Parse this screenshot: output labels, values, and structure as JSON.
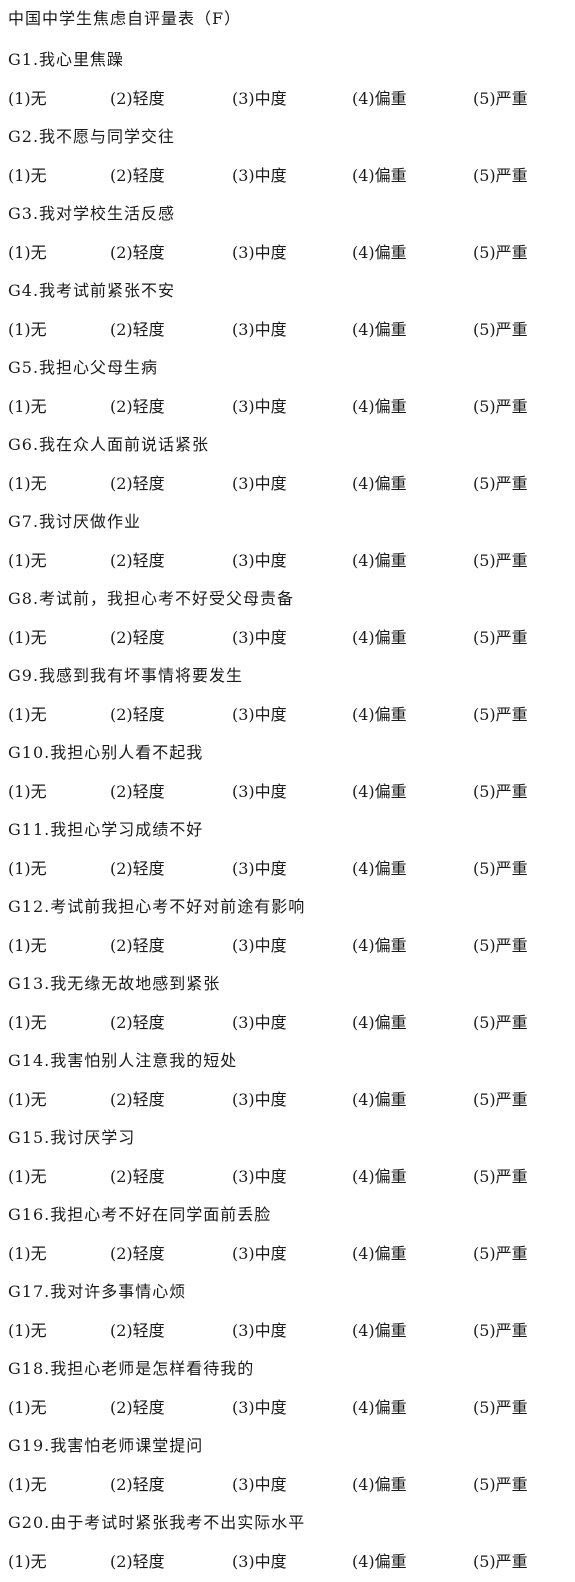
{
  "title": "中国中学生焦虑自评量表（F）",
  "options": [
    "(1)无",
    "(2)轻度",
    "(3)中度",
    "(4)偏重",
    "(5)严重"
  ],
  "questions": [
    "G1.我心里焦躁",
    "G2.我不愿与同学交往",
    "G3.我对学校生活反感",
    "G4.我考试前紧张不安",
    "G5.我担心父母生病",
    "G6.我在众人面前说话紧张",
    "G7.我讨厌做作业",
    "G8.考试前，我担心考不好受父母责备",
    "G9.我感到我有坏事情将要发生",
    "G10.我担心别人看不起我",
    "G11.我担心学习成绩不好",
    "G12.考试前我担心考不好对前途有影响",
    "G13.我无缘无故地感到紧张",
    "G14.我害怕别人注意我的短处",
    "G15.我讨厌学习",
    "G16.我担心考不好在同学面前丢脸",
    "G17.我对许多事情心烦",
    "G18.我担心老师是怎样看待我的",
    "G19.我害怕老师课堂提问",
    "G20.由于考试时紧张我考不出实际水平"
  ]
}
